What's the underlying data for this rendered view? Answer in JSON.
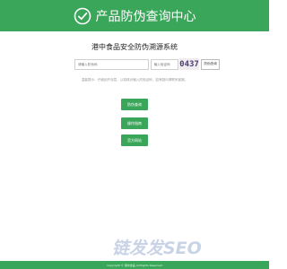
{
  "header": {
    "title": "产品防伪查询中心",
    "logo_icon": "check-circle-icon",
    "background": "#3aa65a"
  },
  "system_title": "港中食品安全防伪溯源系统",
  "query": {
    "code_placeholder": "请输入防伪码",
    "captcha_placeholder": "输入验证码",
    "captcha_text": "0437",
    "query_button": "防伪查询"
  },
  "hint": "温馨提示：仔细刮开涂层，认真核对输入的验证码，如有疑问请联系客服。",
  "actions": {
    "trace_button": "防伪查询",
    "guide_button": "操作指南",
    "site_button": "官方网站"
  },
  "watermark": "链发发SEO",
  "footer": "Copyright © 港中食品 All Rights Reserved"
}
